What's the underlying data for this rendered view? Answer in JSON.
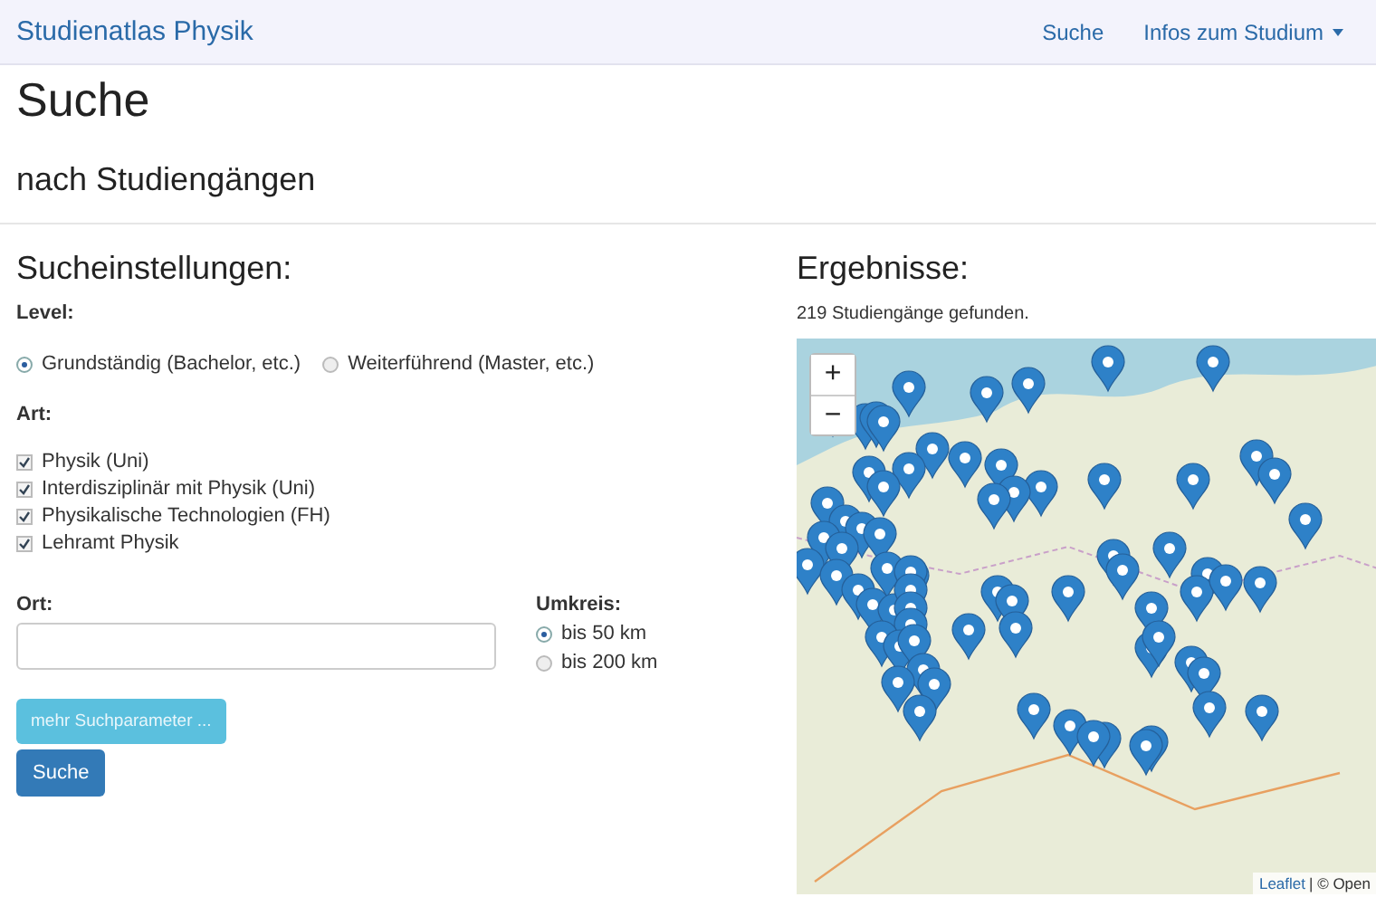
{
  "navbar": {
    "brand": "Studienatlas Physik",
    "links": [
      {
        "label": "Suche",
        "kind": "link"
      },
      {
        "label": "Infos zum Studium",
        "kind": "dropdown"
      }
    ]
  },
  "page": {
    "title": "Suche",
    "subtitle": "nach Studiengängen"
  },
  "settings": {
    "heading": "Sucheinstellungen:",
    "level_label": "Level:",
    "levels": [
      {
        "label": "Grundständig (Bachelor, etc.)",
        "selected": true
      },
      {
        "label": "Weiterführend (Master, etc.)",
        "selected": false
      }
    ],
    "art_label": "Art:",
    "arts": [
      {
        "label": "Physik (Uni)",
        "checked": true
      },
      {
        "label": "Interdisziplinär mit Physik (Uni)",
        "checked": true
      },
      {
        "label": "Physikalische Technologien (FH)",
        "checked": true
      },
      {
        "label": "Lehramt Physik",
        "checked": true
      }
    ],
    "ort_label": "Ort:",
    "umkreis_label": "Umkreis:",
    "radii": [
      {
        "label": "bis 50 km",
        "selected": true
      },
      {
        "label": "bis 200 km",
        "selected": false
      }
    ],
    "more_button": "mehr Suchparameter ...",
    "search_button": "Suche"
  },
  "results": {
    "heading": "Ergebnisse:",
    "count": "219 Studiengänge gefunden.",
    "zoom_in": "+",
    "zoom_out": "−",
    "attribution_link": "Leaflet",
    "attribution_rest": "| © Open"
  }
}
